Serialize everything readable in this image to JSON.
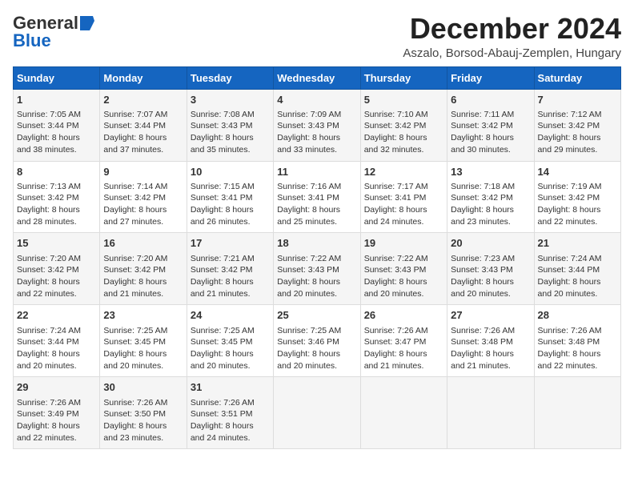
{
  "logo": {
    "general": "General",
    "blue": "Blue"
  },
  "title": "December 2024",
  "subtitle": "Aszalo, Borsod-Abauj-Zemplen, Hungary",
  "headers": [
    "Sunday",
    "Monday",
    "Tuesday",
    "Wednesday",
    "Thursday",
    "Friday",
    "Saturday"
  ],
  "weeks": [
    [
      {
        "day": "1",
        "sunrise": "7:05 AM",
        "sunset": "3:44 PM",
        "daylight": "8 hours and 38 minutes."
      },
      {
        "day": "2",
        "sunrise": "7:07 AM",
        "sunset": "3:44 PM",
        "daylight": "8 hours and 37 minutes."
      },
      {
        "day": "3",
        "sunrise": "7:08 AM",
        "sunset": "3:43 PM",
        "daylight": "8 hours and 35 minutes."
      },
      {
        "day": "4",
        "sunrise": "7:09 AM",
        "sunset": "3:43 PM",
        "daylight": "8 hours and 33 minutes."
      },
      {
        "day": "5",
        "sunrise": "7:10 AM",
        "sunset": "3:42 PM",
        "daylight": "8 hours and 32 minutes."
      },
      {
        "day": "6",
        "sunrise": "7:11 AM",
        "sunset": "3:42 PM",
        "daylight": "8 hours and 30 minutes."
      },
      {
        "day": "7",
        "sunrise": "7:12 AM",
        "sunset": "3:42 PM",
        "daylight": "8 hours and 29 minutes."
      }
    ],
    [
      {
        "day": "8",
        "sunrise": "7:13 AM",
        "sunset": "3:42 PM",
        "daylight": "8 hours and 28 minutes."
      },
      {
        "day": "9",
        "sunrise": "7:14 AM",
        "sunset": "3:42 PM",
        "daylight": "8 hours and 27 minutes."
      },
      {
        "day": "10",
        "sunrise": "7:15 AM",
        "sunset": "3:41 PM",
        "daylight": "8 hours and 26 minutes."
      },
      {
        "day": "11",
        "sunrise": "7:16 AM",
        "sunset": "3:41 PM",
        "daylight": "8 hours and 25 minutes."
      },
      {
        "day": "12",
        "sunrise": "7:17 AM",
        "sunset": "3:41 PM",
        "daylight": "8 hours and 24 minutes."
      },
      {
        "day": "13",
        "sunrise": "7:18 AM",
        "sunset": "3:42 PM",
        "daylight": "8 hours and 23 minutes."
      },
      {
        "day": "14",
        "sunrise": "7:19 AM",
        "sunset": "3:42 PM",
        "daylight": "8 hours and 22 minutes."
      }
    ],
    [
      {
        "day": "15",
        "sunrise": "7:20 AM",
        "sunset": "3:42 PM",
        "daylight": "8 hours and 22 minutes."
      },
      {
        "day": "16",
        "sunrise": "7:20 AM",
        "sunset": "3:42 PM",
        "daylight": "8 hours and 21 minutes."
      },
      {
        "day": "17",
        "sunrise": "7:21 AM",
        "sunset": "3:42 PM",
        "daylight": "8 hours and 21 minutes."
      },
      {
        "day": "18",
        "sunrise": "7:22 AM",
        "sunset": "3:43 PM",
        "daylight": "8 hours and 20 minutes."
      },
      {
        "day": "19",
        "sunrise": "7:22 AM",
        "sunset": "3:43 PM",
        "daylight": "8 hours and 20 minutes."
      },
      {
        "day": "20",
        "sunrise": "7:23 AM",
        "sunset": "3:43 PM",
        "daylight": "8 hours and 20 minutes."
      },
      {
        "day": "21",
        "sunrise": "7:24 AM",
        "sunset": "3:44 PM",
        "daylight": "8 hours and 20 minutes."
      }
    ],
    [
      {
        "day": "22",
        "sunrise": "7:24 AM",
        "sunset": "3:44 PM",
        "daylight": "8 hours and 20 minutes."
      },
      {
        "day": "23",
        "sunrise": "7:25 AM",
        "sunset": "3:45 PM",
        "daylight": "8 hours and 20 minutes."
      },
      {
        "day": "24",
        "sunrise": "7:25 AM",
        "sunset": "3:45 PM",
        "daylight": "8 hours and 20 minutes."
      },
      {
        "day": "25",
        "sunrise": "7:25 AM",
        "sunset": "3:46 PM",
        "daylight": "8 hours and 20 minutes."
      },
      {
        "day": "26",
        "sunrise": "7:26 AM",
        "sunset": "3:47 PM",
        "daylight": "8 hours and 21 minutes."
      },
      {
        "day": "27",
        "sunrise": "7:26 AM",
        "sunset": "3:48 PM",
        "daylight": "8 hours and 21 minutes."
      },
      {
        "day": "28",
        "sunrise": "7:26 AM",
        "sunset": "3:48 PM",
        "daylight": "8 hours and 22 minutes."
      }
    ],
    [
      {
        "day": "29",
        "sunrise": "7:26 AM",
        "sunset": "3:49 PM",
        "daylight": "8 hours and 22 minutes."
      },
      {
        "day": "30",
        "sunrise": "7:26 AM",
        "sunset": "3:50 PM",
        "daylight": "8 hours and 23 minutes."
      },
      {
        "day": "31",
        "sunrise": "7:26 AM",
        "sunset": "3:51 PM",
        "daylight": "8 hours and 24 minutes."
      },
      null,
      null,
      null,
      null
    ]
  ],
  "labels": {
    "sunrise": "Sunrise:",
    "sunset": "Sunset:",
    "daylight": "Daylight:"
  }
}
